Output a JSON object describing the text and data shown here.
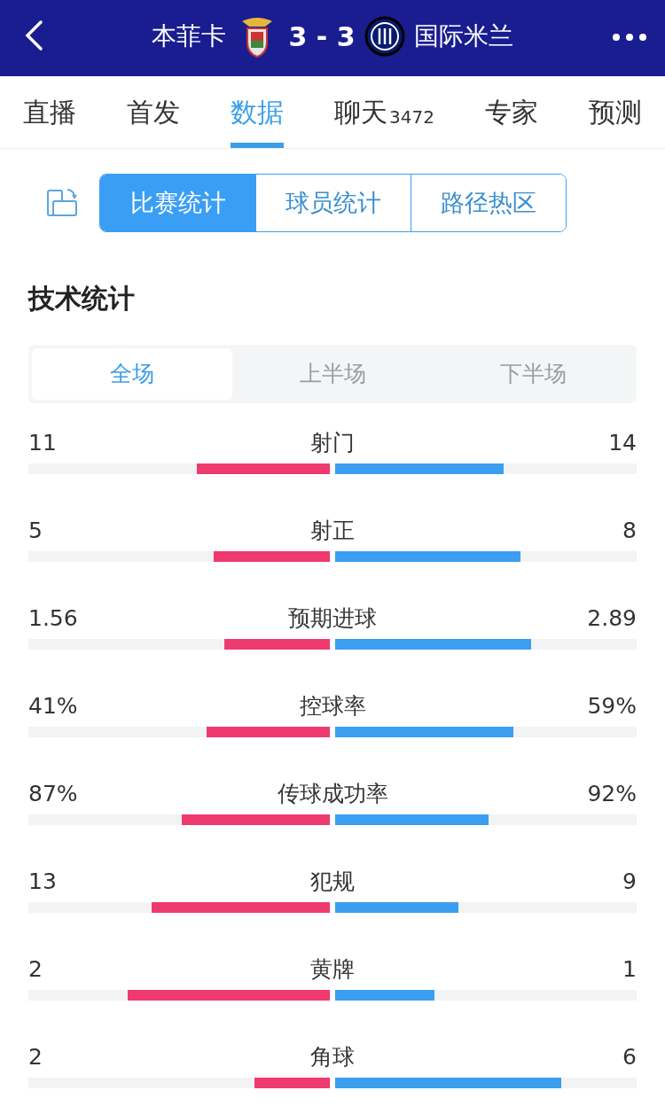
{
  "header": {
    "home_team": "本菲卡",
    "score": "3 - 3",
    "away_team": "国际米兰"
  },
  "tabs": [
    {
      "label": "直播",
      "selected": false
    },
    {
      "label": "首发",
      "selected": false
    },
    {
      "label": "数据",
      "selected": true
    },
    {
      "label": "聊天",
      "count": "3472",
      "selected": false
    },
    {
      "label": "专家",
      "selected": false
    },
    {
      "label": "预测",
      "selected": false
    }
  ],
  "segments": [
    {
      "label": "比赛统计",
      "selected": true
    },
    {
      "label": "球员统计",
      "selected": false
    },
    {
      "label": "路径热区",
      "selected": false
    }
  ],
  "section_title": "技术统计",
  "periods": [
    {
      "label": "全场",
      "selected": true
    },
    {
      "label": "上半场",
      "selected": false
    },
    {
      "label": "下半场",
      "selected": false
    }
  ],
  "stats": [
    {
      "name": "射门",
      "home": {
        "value": "11",
        "level": 0.44
      },
      "away": {
        "value": "14",
        "level": 0.56
      }
    },
    {
      "name": "射正",
      "home": {
        "value": "5",
        "level": 0.385
      },
      "away": {
        "value": "8",
        "level": 0.615
      }
    },
    {
      "name": "预期进球",
      "home": {
        "value": "1.56",
        "level": 0.35
      },
      "away": {
        "value": "2.89",
        "level": 0.65
      }
    },
    {
      "name": "控球率",
      "home": {
        "value": "41%",
        "level": 0.41
      },
      "away": {
        "value": "59%",
        "level": 0.59
      }
    },
    {
      "name": "传球成功率",
      "home": {
        "value": "87%",
        "level": 0.49
      },
      "away": {
        "value": "92%",
        "level": 0.51
      }
    },
    {
      "name": "犯规",
      "home": {
        "value": "13",
        "level": 0.59
      },
      "away": {
        "value": "9",
        "level": 0.41
      }
    },
    {
      "name": "黄牌",
      "home": {
        "value": "2",
        "level": 0.67
      },
      "away": {
        "value": "1",
        "level": 0.33
      }
    },
    {
      "name": "角球",
      "home": {
        "value": "2",
        "level": 0.25
      },
      "away": {
        "value": "6",
        "level": 0.75
      }
    }
  ]
}
